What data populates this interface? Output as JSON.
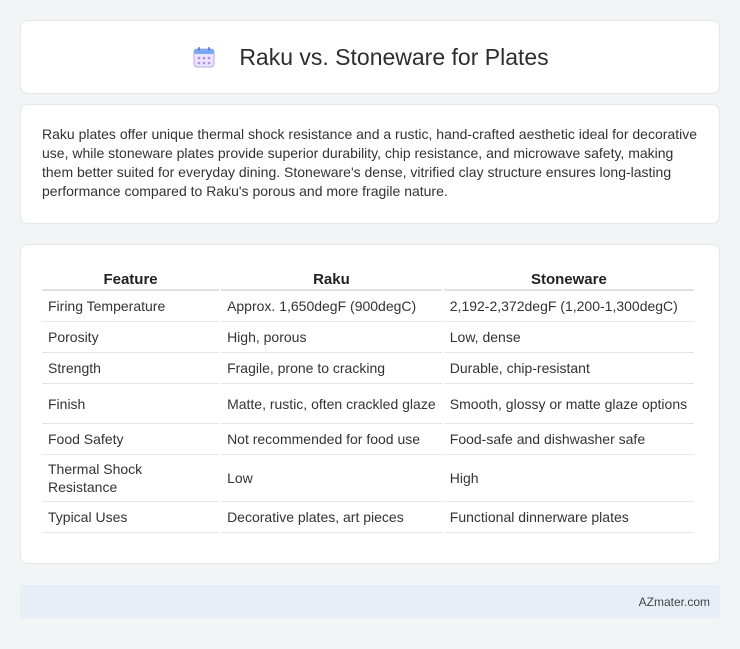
{
  "header": {
    "title": "Raku vs. Stoneware for Plates",
    "icon": "calendar-icon"
  },
  "summary": {
    "text": "Raku plates offer unique thermal shock resistance and a rustic, hand-crafted aesthetic ideal for decorative use, while stoneware plates provide superior durability, chip resistance, and microwave safety, making them better suited for everyday dining. Stoneware's dense, vitrified clay structure ensures long-lasting performance compared to Raku's porous and more fragile nature."
  },
  "table": {
    "headers": [
      "Feature",
      "Raku",
      "Stoneware"
    ],
    "rows": [
      [
        "Firing Temperature",
        "Approx. 1,650degF (900degC)",
        "2,192-2,372degF (1,200-1,300degC)"
      ],
      [
        "Porosity",
        "High, porous",
        "Low, dense"
      ],
      [
        "Strength",
        "Fragile, prone to cracking",
        "Durable, chip-resistant"
      ],
      [
        "Finish",
        "Matte, rustic, often crackled glaze",
        "Smooth, glossy or matte glaze options"
      ],
      [
        "Food Safety",
        "Not recommended for food use",
        "Food-safe and dishwasher safe"
      ],
      [
        "Thermal Shock Resistance",
        "Low",
        "High"
      ],
      [
        "Typical Uses",
        "Decorative plates, art pieces",
        "Functional dinnerware plates"
      ]
    ]
  },
  "footer": {
    "brand": "AZmater.com"
  }
}
